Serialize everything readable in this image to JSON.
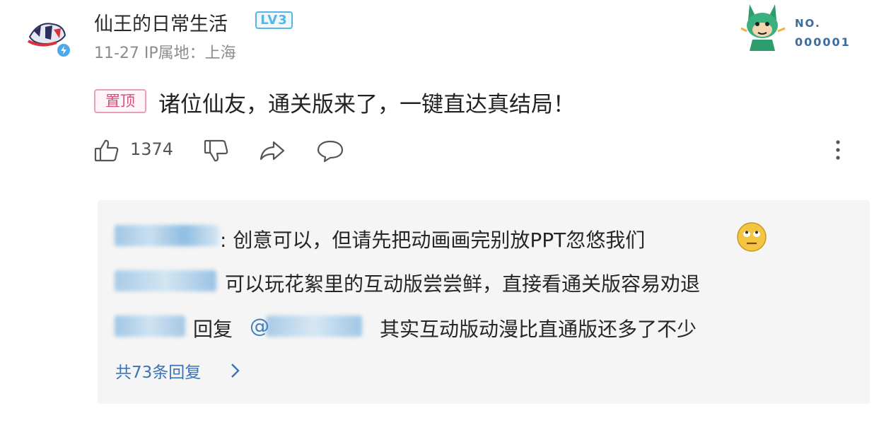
{
  "post": {
    "username": "仙王的日常生活",
    "level_badge": "LV3",
    "meta": "11-27 IP属地：上海",
    "pinned_tag": "置顶",
    "title": "诸位仙友，通关版来了，一键直达真结局！",
    "like_count": "1374"
  },
  "badge": {
    "label": "NO.",
    "number": "000001"
  },
  "replies": {
    "reply1_text": ": 创意可以，但请先把动画画完别放PPT忽悠我们",
    "reply2_text": "可以玩花絮里的互动版尝尝鲜，直接看通关版容易劝退",
    "reply3_prefix": "回复",
    "reply3_mention": "@",
    "reply3_text": "其实互动版动漫比直通版还多了不少",
    "more_label": "共73条回复"
  },
  "icons": {
    "like": "thumbs-up-icon",
    "dislike": "thumbs-down-icon",
    "share": "share-icon",
    "comment": "comment-icon",
    "more": "more-vertical-icon",
    "verified": "verified-icon",
    "emoji": "eye-roll-emoji-icon",
    "chevron": "chevron-right-icon"
  },
  "colors": {
    "accent_blue": "#3a73b8",
    "level_blue": "#58b5e6",
    "pin_pink": "#d34f7e",
    "reply_bg": "#f5f5f5"
  }
}
